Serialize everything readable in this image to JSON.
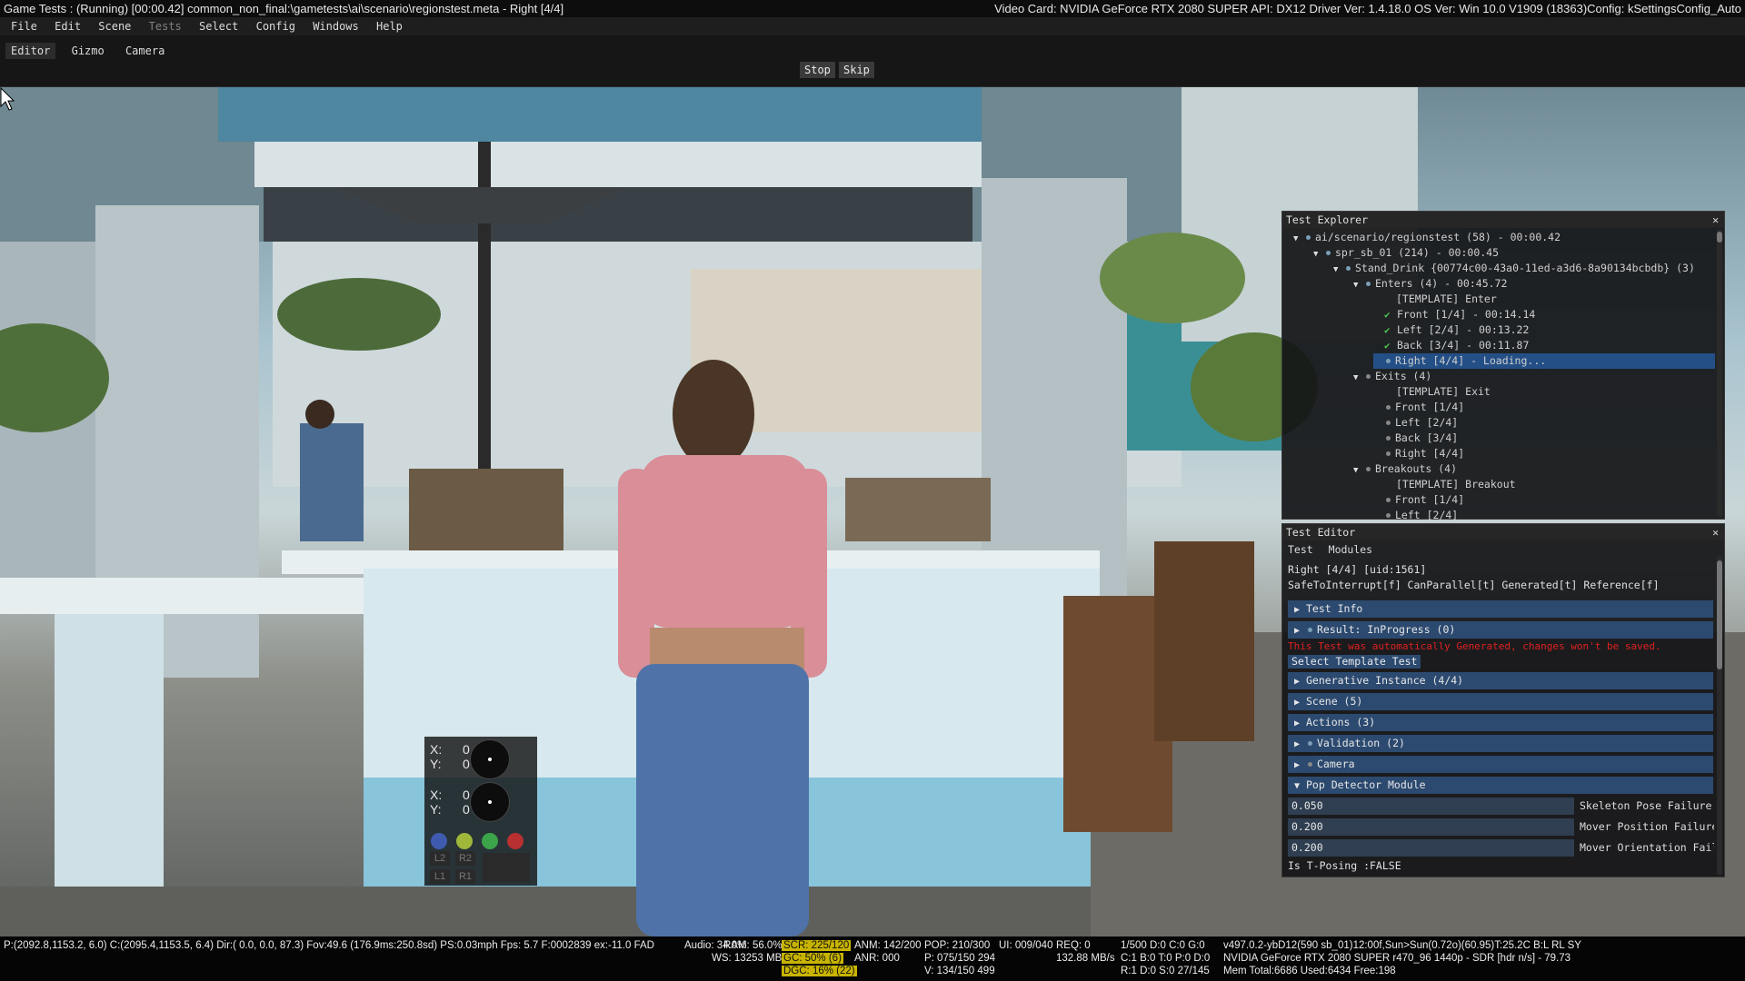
{
  "titlebar": {
    "left": "Game Tests : (Running) [00:00.42] common_non_final:\\gametests\\ai\\scenario\\regionstest.meta - Right [4/4]",
    "right": "Video Card: NVIDIA GeForce RTX 2080 SUPER API: DX12 Driver Ver: 1.4.18.0 OS Ver: Win 10.0 V1909 (18363)Config: kSettingsConfig_Auto"
  },
  "menu": {
    "items": [
      "File",
      "Edit",
      "Scene",
      "Tests",
      "Select",
      "Config",
      "Windows",
      "Help"
    ],
    "disabled": [
      "Tests"
    ]
  },
  "toolbar": {
    "tabs": [
      "Editor",
      "Gizmo",
      "Camera"
    ],
    "stop_label": "Stop",
    "skip_label": "Skip"
  },
  "gamepad": {
    "left_stick": {
      "x_label": "X:",
      "x": "0",
      "y_label": "Y:",
      "y": "0"
    },
    "right_stick": {
      "x_label": "X:",
      "x": "0",
      "y_label": "Y:",
      "y": "0"
    },
    "face_colors": [
      "#3f5bb0",
      "#9fb83a",
      "#3ca44a",
      "#b83030"
    ],
    "shoulders": [
      "L2",
      "R2",
      "L1",
      "R1"
    ]
  },
  "test_explorer": {
    "title": "Test Explorer",
    "close": "✕",
    "rows": [
      {
        "text": "ai/scenario/regionstest (58) - 00:00.42",
        "arrow": "▼",
        "marker": "dot"
      },
      {
        "text": "spr_sb_01 (214) - 00:00.45",
        "arrow": "▼",
        "marker": "dot"
      },
      {
        "text": "Stand_Drink {00774c00-43a0-11ed-a3d6-8a90134bcbdb} (3)",
        "arrow": "▼",
        "marker": "dot"
      },
      {
        "text": "Enters (4) - 00:45.72",
        "arrow": "▼",
        "marker": "dot"
      },
      {
        "text": "[TEMPLATE] Enter",
        "arrow": "",
        "marker": "none"
      },
      {
        "text": "Front [1/4] - 00:14.14",
        "arrow": "",
        "marker": "check"
      },
      {
        "text": "Left [2/4] - 00:13.22",
        "arrow": "",
        "marker": "check"
      },
      {
        "text": "Back [3/4] - 00:11.87",
        "arrow": "",
        "marker": "check"
      },
      {
        "text": "Right [4/4] - Loading...",
        "arrow": "",
        "marker": "dot",
        "selected": true
      },
      {
        "text": "Exits (4)",
        "arrow": "▼",
        "marker": "gray"
      },
      {
        "text": "[TEMPLATE] Exit",
        "arrow": "",
        "marker": "none"
      },
      {
        "text": "Front [1/4]",
        "arrow": "",
        "marker": "gray"
      },
      {
        "text": "Left [2/4]",
        "arrow": "",
        "marker": "gray"
      },
      {
        "text": "Back [3/4]",
        "arrow": "",
        "marker": "gray"
      },
      {
        "text": "Right [4/4]",
        "arrow": "",
        "marker": "gray"
      },
      {
        "text": "Breakouts (4)",
        "arrow": "▼",
        "marker": "gray"
      },
      {
        "text": "[TEMPLATE] Breakout",
        "arrow": "",
        "marker": "none"
      },
      {
        "text": "Front [1/4]",
        "arrow": "",
        "marker": "gray"
      },
      {
        "text": "Left [2/4]",
        "arrow": "",
        "marker": "gray"
      }
    ]
  },
  "test_editor": {
    "title": "Test Editor",
    "close": "✕",
    "tabs": [
      "Test",
      "Modules"
    ],
    "name_line": "Right [4/4] [uid:1561]",
    "flags_line": "SafeToInterrupt[f] CanParallel[t] Generated[t] Reference[f]",
    "warning": "This Test was automatically Generated, changes won't be saved.",
    "warning_color": "#e02020",
    "select_template": "Select Template Test",
    "sections": {
      "test_info": "Test Info",
      "result": "Result: InProgress (0)",
      "generative": "Generative Instance (4/4)",
      "scene": "Scene (5)",
      "actions": "Actions (3)",
      "validation": "Validation (2)",
      "camera": "Camera",
      "pop_detector": "Pop Detector Module"
    },
    "fields": [
      {
        "value": "0.050",
        "label": "Skeleton Pose Failure"
      },
      {
        "value": "0.200",
        "label": "Mover Position Failure"
      },
      {
        "value": "0.200",
        "label": "Mover Orientation Failure"
      }
    ],
    "tposing": "Is T-Posing :FALSE"
  },
  "status": {
    "position": "P:(2092.8,1153.2,  6.0) C:(2095.4,1153.5,  6.4) Dir:( 0.0,  0.0, 87.3) Fov:49.6 (176.9ms:250.8sd) PS:0.03mph  Fps: 5.7 F:0002839 ex:-11.0 FAD",
    "audio": "Audio: 34.0%",
    "ram": "RAM: 56.0%",
    "ws": "WS: 13253 MB",
    "scr": "SCR: 225/120",
    "gc": "GC: 50% (6)",
    "dgc": "DGC: 16% (22)",
    "anm": "ANM: 142/200",
    "anr": "ANR: 000",
    "pop": "POP: 210/300",
    "pop_p": "P: 075/150 294",
    "pop_v": "V: 134/150 499",
    "ui": "UI: 009/040",
    "req": "REQ: 0",
    "mbs": "132.88 MB/s",
    "d1": "1/500 D:0 C:0 G:0",
    "d2": "C:1 B:0 T:0 P:0 D:0",
    "d3": "R:1 D:0 S:0 27/145",
    "build": "v497.0.2-ybD12(590 sb_01)12:00f,Sun>Sun(0.72o)(60.95)T:25.2C B:L RL SY",
    "gpu": "NVIDIA GeForce RTX 2080 SUPER r470_96 1440p - SDR [hdr n/s] - 79.73",
    "mem": "Mem Total:6686 Used:6434 Free:198"
  }
}
